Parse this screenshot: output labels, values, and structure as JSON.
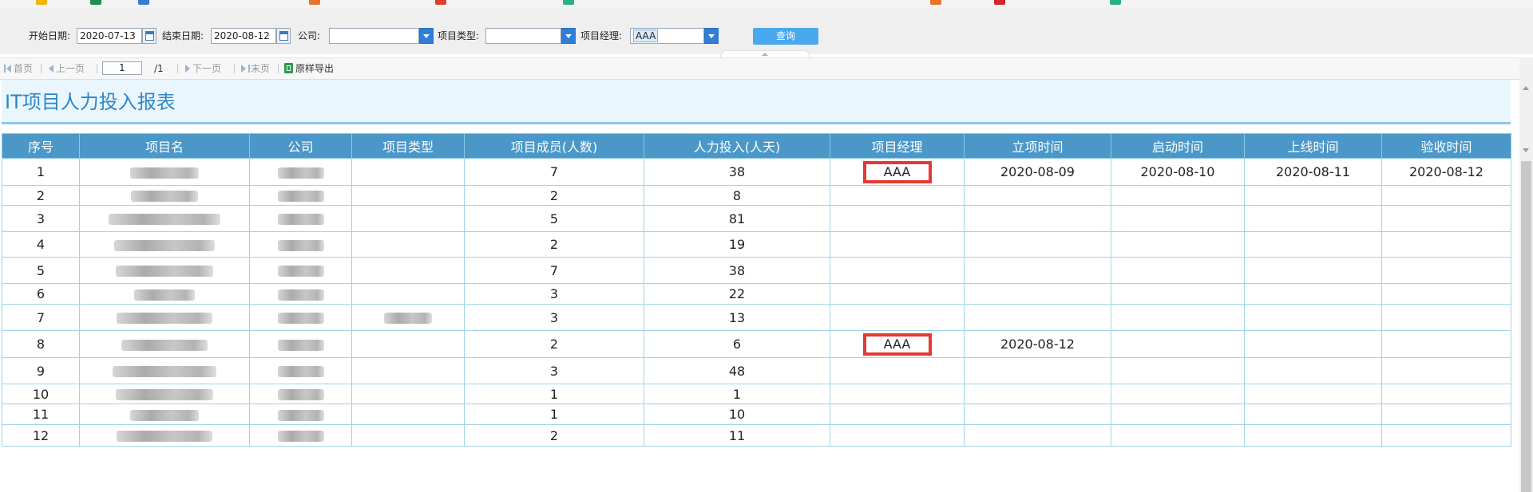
{
  "filter": {
    "start_date_label": "开始日期:",
    "start_date_value": "2020-07-13",
    "end_date_label": "结束日期:",
    "end_date_value": "2020-08-12",
    "company_label": "公司:",
    "company_value": "",
    "project_type_label": "项目类型:",
    "project_type_value": "",
    "manager_label": "项目经理:",
    "manager_value": "AAA",
    "query_label": "查询"
  },
  "pager": {
    "first": "首页",
    "prev": "上一页",
    "page_input": "1",
    "total": "/1",
    "next": "下一页",
    "last": "末页",
    "export": "原样导出"
  },
  "report": {
    "title": "IT项目人力投入报表",
    "columns": [
      "序号",
      "项目名",
      "公司",
      "项目类型",
      "项目成员(人数)",
      "人力投入(人天)",
      "项目经理",
      "立项时间",
      "启动时间",
      "上线时间",
      "验收时间"
    ],
    "rows": [
      {
        "no": "1",
        "members": "7",
        "effort": "38",
        "manager": "AAA",
        "setup": "2020-08-09",
        "start": "2020-08-10",
        "online": "2020-08-11",
        "accept": "2020-08-12"
      },
      {
        "no": "2",
        "members": "2",
        "effort": "8",
        "manager": "",
        "setup": "",
        "start": "",
        "online": "",
        "accept": ""
      },
      {
        "no": "3",
        "members": "5",
        "effort": "81",
        "manager": "",
        "setup": "",
        "start": "",
        "online": "",
        "accept": ""
      },
      {
        "no": "4",
        "members": "2",
        "effort": "19",
        "manager": "",
        "setup": "",
        "start": "",
        "online": "",
        "accept": ""
      },
      {
        "no": "5",
        "members": "7",
        "effort": "38",
        "manager": "",
        "setup": "",
        "start": "",
        "online": "",
        "accept": ""
      },
      {
        "no": "6",
        "members": "3",
        "effort": "22",
        "manager": "",
        "setup": "",
        "start": "",
        "online": "",
        "accept": ""
      },
      {
        "no": "7",
        "members": "3",
        "effort": "13",
        "manager": "",
        "setup": "",
        "start": "",
        "online": "",
        "accept": ""
      },
      {
        "no": "8",
        "members": "2",
        "effort": "6",
        "manager": "AAA",
        "setup": "2020-08-12",
        "start": "",
        "online": "",
        "accept": ""
      },
      {
        "no": "9",
        "members": "3",
        "effort": "48",
        "manager": "",
        "setup": "",
        "start": "",
        "online": "",
        "accept": ""
      },
      {
        "no": "10",
        "members": "1",
        "effort": "1",
        "manager": "",
        "setup": "",
        "start": "",
        "online": "",
        "accept": ""
      },
      {
        "no": "11",
        "members": "1",
        "effort": "10",
        "manager": "",
        "setup": "",
        "start": "",
        "online": "",
        "accept": ""
      },
      {
        "no": "12",
        "members": "2",
        "effort": "11",
        "manager": "",
        "setup": "",
        "start": "",
        "online": "",
        "accept": ""
      }
    ]
  },
  "colors": {
    "header_bg": "#4a97c8",
    "title_text": "#2f86c6",
    "highlight_box": "#e53935",
    "query_button": "#49a8ee"
  }
}
